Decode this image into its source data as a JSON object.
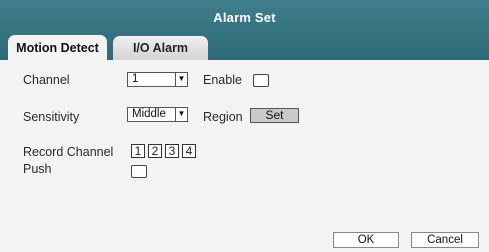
{
  "window": {
    "title": "Alarm Set"
  },
  "tabs": [
    {
      "label": "Motion Detect",
      "active": true
    },
    {
      "label": "I/O Alarm",
      "active": false
    }
  ],
  "form": {
    "channel": {
      "label": "Channel",
      "value": "1"
    },
    "enable": {
      "label": "Enable",
      "checked": false
    },
    "sensitivity": {
      "label": "Sensitivity",
      "value": "Middle"
    },
    "region": {
      "label": "Region",
      "button": "Set"
    },
    "record_channel": {
      "label": "Record Channel",
      "options": [
        "1",
        "2",
        "3",
        "4"
      ]
    },
    "push": {
      "label": "Push",
      "checked": false
    }
  },
  "footer": {
    "ok": "OK",
    "cancel": "Cancel"
  },
  "colors": {
    "titlebar": "#2f6a78",
    "panel": "#f3f3f3",
    "set_button": "#c9c9c9"
  }
}
